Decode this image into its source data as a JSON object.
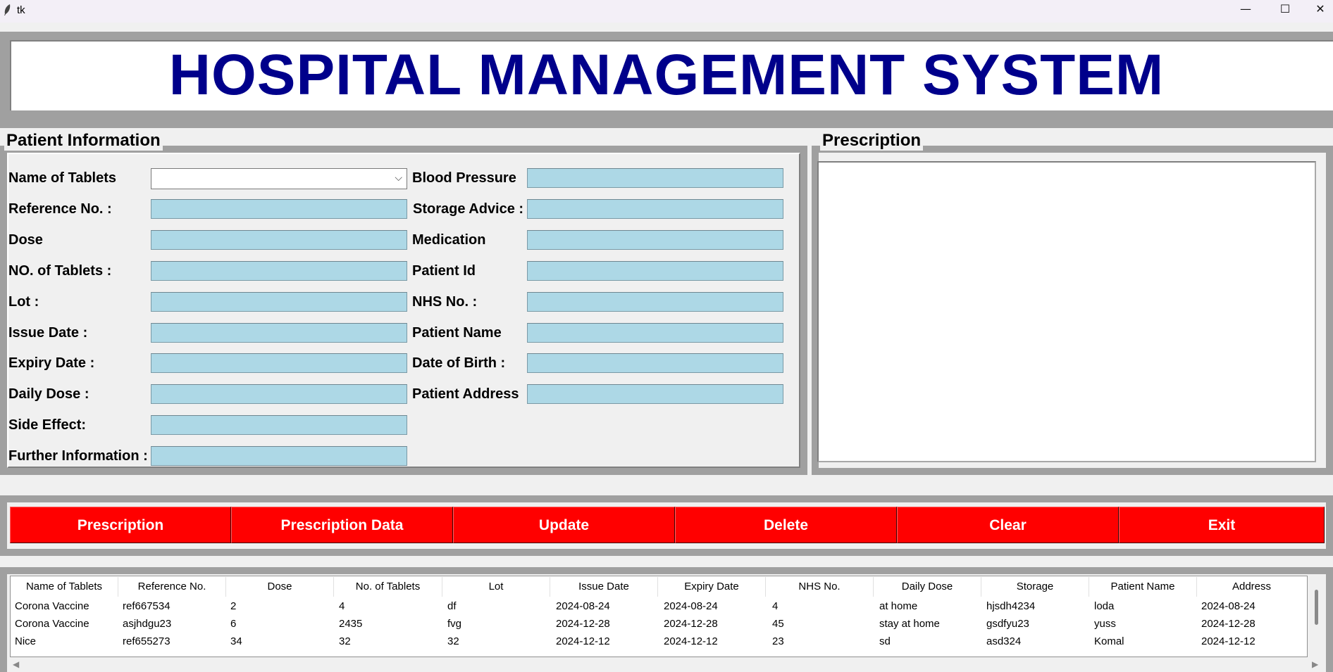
{
  "window": {
    "title": "tk",
    "minimize": "—",
    "maximize": "☐",
    "close": "✕"
  },
  "header": {
    "title": "HOSPITAL MANAGEMENT SYSTEM"
  },
  "patient_info": {
    "label": "Patient Information",
    "left_fields": [
      {
        "label": "Name of Tablets",
        "value": "",
        "kind": "combo"
      },
      {
        "label": "Reference No. :",
        "value": ""
      },
      {
        "label": "Dose",
        "value": ""
      },
      {
        "label": "NO. of Tablets :",
        "value": ""
      },
      {
        "label": "Lot :",
        "value": ""
      },
      {
        "label": "Issue Date :",
        "value": ""
      },
      {
        "label": "Expiry Date :",
        "value": ""
      },
      {
        "label": "Daily Dose :",
        "value": ""
      },
      {
        "label": "Side Effect:",
        "value": ""
      },
      {
        "label": "Further Information :",
        "value": ""
      }
    ],
    "right_fields": [
      {
        "label": "Blood Pressure",
        "value": ""
      },
      {
        "label": "Storage Advice :",
        "value": ""
      },
      {
        "label": "Medication",
        "value": ""
      },
      {
        "label": "Patient Id",
        "value": ""
      },
      {
        "label": "NHS No. :",
        "value": ""
      },
      {
        "label": "Patient Name",
        "value": ""
      },
      {
        "label": "Date of Birth :",
        "value": ""
      },
      {
        "label": "Patient Address",
        "value": ""
      }
    ]
  },
  "prescription": {
    "label": "Prescription",
    "text": ""
  },
  "buttons": [
    "Prescription",
    "Prescription Data",
    "Update",
    "Delete",
    "Clear",
    "Exit"
  ],
  "table": {
    "columns": [
      "Name of Tablets",
      "Reference No.",
      "Dose",
      "No. of Tablets",
      "Lot",
      "Issue Date",
      "Expiry Date",
      "NHS No.",
      "Daily Dose",
      "Storage",
      "Patient Name",
      "Address"
    ],
    "rows": [
      [
        "Corona Vaccine",
        "ref667534",
        "2",
        "4",
        "df",
        "2024-08-24",
        "2024-08-24",
        "4",
        "at home",
        "hjsdh4234",
        "loda",
        "2024-08-24"
      ],
      [
        "Corona Vaccine",
        "asjhdgu23",
        "6",
        "2435",
        "fvg",
        "2024-12-28",
        "2024-12-28",
        "45",
        "stay at home",
        "gsdfyu23",
        "yuss",
        "2024-12-28"
      ],
      [
        "Nice",
        "ref655273",
        "34",
        "32",
        "32",
        "2024-12-12",
        "2024-12-12",
        "23",
        "sd",
        "asd324",
        "Komal",
        "2024-12-12"
      ]
    ]
  },
  "colors": {
    "title": "#00008b",
    "entry_bg": "#add8e6",
    "button_bg": "#ff0000",
    "frame": "#a0a0a0"
  }
}
